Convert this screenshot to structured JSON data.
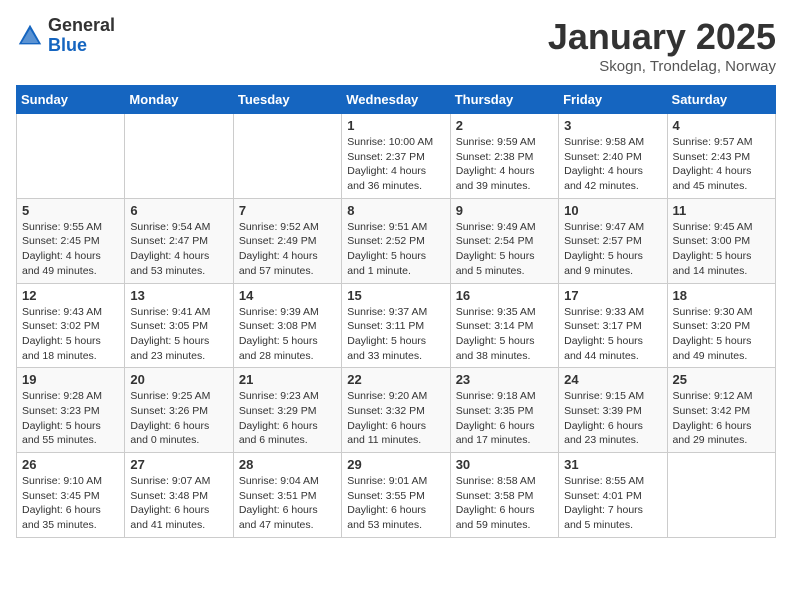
{
  "header": {
    "logo_general": "General",
    "logo_blue": "Blue",
    "month_title": "January 2025",
    "subtitle": "Skogn, Trondelag, Norway"
  },
  "weekdays": [
    "Sunday",
    "Monday",
    "Tuesday",
    "Wednesday",
    "Thursday",
    "Friday",
    "Saturday"
  ],
  "weeks": [
    [
      {
        "day": null,
        "info": ""
      },
      {
        "day": null,
        "info": ""
      },
      {
        "day": null,
        "info": ""
      },
      {
        "day": "1",
        "info": "Sunrise: 10:00 AM\nSunset: 2:37 PM\nDaylight: 4 hours\nand 36 minutes."
      },
      {
        "day": "2",
        "info": "Sunrise: 9:59 AM\nSunset: 2:38 PM\nDaylight: 4 hours\nand 39 minutes."
      },
      {
        "day": "3",
        "info": "Sunrise: 9:58 AM\nSunset: 2:40 PM\nDaylight: 4 hours\nand 42 minutes."
      },
      {
        "day": "4",
        "info": "Sunrise: 9:57 AM\nSunset: 2:43 PM\nDaylight: 4 hours\nand 45 minutes."
      }
    ],
    [
      {
        "day": "5",
        "info": "Sunrise: 9:55 AM\nSunset: 2:45 PM\nDaylight: 4 hours\nand 49 minutes."
      },
      {
        "day": "6",
        "info": "Sunrise: 9:54 AM\nSunset: 2:47 PM\nDaylight: 4 hours\nand 53 minutes."
      },
      {
        "day": "7",
        "info": "Sunrise: 9:52 AM\nSunset: 2:49 PM\nDaylight: 4 hours\nand 57 minutes."
      },
      {
        "day": "8",
        "info": "Sunrise: 9:51 AM\nSunset: 2:52 PM\nDaylight: 5 hours\nand 1 minute."
      },
      {
        "day": "9",
        "info": "Sunrise: 9:49 AM\nSunset: 2:54 PM\nDaylight: 5 hours\nand 5 minutes."
      },
      {
        "day": "10",
        "info": "Sunrise: 9:47 AM\nSunset: 2:57 PM\nDaylight: 5 hours\nand 9 minutes."
      },
      {
        "day": "11",
        "info": "Sunrise: 9:45 AM\nSunset: 3:00 PM\nDaylight: 5 hours\nand 14 minutes."
      }
    ],
    [
      {
        "day": "12",
        "info": "Sunrise: 9:43 AM\nSunset: 3:02 PM\nDaylight: 5 hours\nand 18 minutes."
      },
      {
        "day": "13",
        "info": "Sunrise: 9:41 AM\nSunset: 3:05 PM\nDaylight: 5 hours\nand 23 minutes."
      },
      {
        "day": "14",
        "info": "Sunrise: 9:39 AM\nSunset: 3:08 PM\nDaylight: 5 hours\nand 28 minutes."
      },
      {
        "day": "15",
        "info": "Sunrise: 9:37 AM\nSunset: 3:11 PM\nDaylight: 5 hours\nand 33 minutes."
      },
      {
        "day": "16",
        "info": "Sunrise: 9:35 AM\nSunset: 3:14 PM\nDaylight: 5 hours\nand 38 minutes."
      },
      {
        "day": "17",
        "info": "Sunrise: 9:33 AM\nSunset: 3:17 PM\nDaylight: 5 hours\nand 44 minutes."
      },
      {
        "day": "18",
        "info": "Sunrise: 9:30 AM\nSunset: 3:20 PM\nDaylight: 5 hours\nand 49 minutes."
      }
    ],
    [
      {
        "day": "19",
        "info": "Sunrise: 9:28 AM\nSunset: 3:23 PM\nDaylight: 5 hours\nand 55 minutes."
      },
      {
        "day": "20",
        "info": "Sunrise: 9:25 AM\nSunset: 3:26 PM\nDaylight: 6 hours\nand 0 minutes."
      },
      {
        "day": "21",
        "info": "Sunrise: 9:23 AM\nSunset: 3:29 PM\nDaylight: 6 hours\nand 6 minutes."
      },
      {
        "day": "22",
        "info": "Sunrise: 9:20 AM\nSunset: 3:32 PM\nDaylight: 6 hours\nand 11 minutes."
      },
      {
        "day": "23",
        "info": "Sunrise: 9:18 AM\nSunset: 3:35 PM\nDaylight: 6 hours\nand 17 minutes."
      },
      {
        "day": "24",
        "info": "Sunrise: 9:15 AM\nSunset: 3:39 PM\nDaylight: 6 hours\nand 23 minutes."
      },
      {
        "day": "25",
        "info": "Sunrise: 9:12 AM\nSunset: 3:42 PM\nDaylight: 6 hours\nand 29 minutes."
      }
    ],
    [
      {
        "day": "26",
        "info": "Sunrise: 9:10 AM\nSunset: 3:45 PM\nDaylight: 6 hours\nand 35 minutes."
      },
      {
        "day": "27",
        "info": "Sunrise: 9:07 AM\nSunset: 3:48 PM\nDaylight: 6 hours\nand 41 minutes."
      },
      {
        "day": "28",
        "info": "Sunrise: 9:04 AM\nSunset: 3:51 PM\nDaylight: 6 hours\nand 47 minutes."
      },
      {
        "day": "29",
        "info": "Sunrise: 9:01 AM\nSunset: 3:55 PM\nDaylight: 6 hours\nand 53 minutes."
      },
      {
        "day": "30",
        "info": "Sunrise: 8:58 AM\nSunset: 3:58 PM\nDaylight: 6 hours\nand 59 minutes."
      },
      {
        "day": "31",
        "info": "Sunrise: 8:55 AM\nSunset: 4:01 PM\nDaylight: 7 hours\nand 5 minutes."
      },
      {
        "day": null,
        "info": ""
      }
    ]
  ]
}
